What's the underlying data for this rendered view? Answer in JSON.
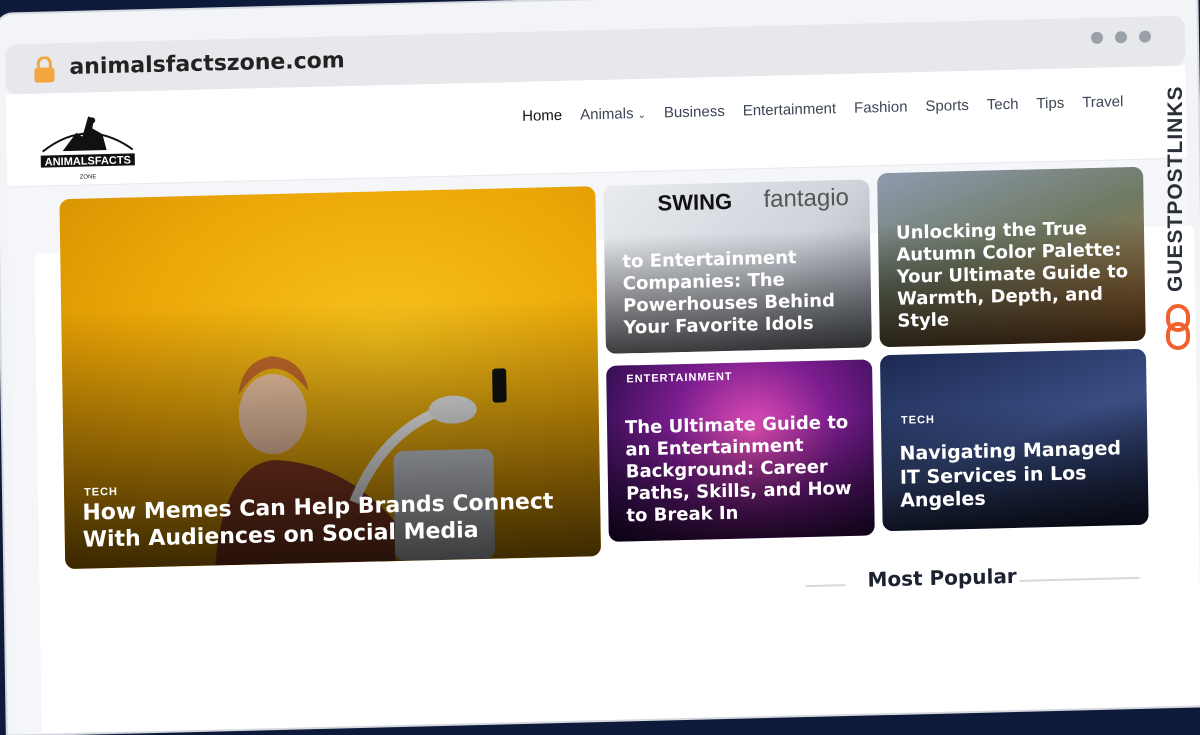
{
  "browser": {
    "url": "animalsfactszone.com"
  },
  "site": {
    "logo": {
      "name": "ANIMALSFACTS",
      "sub": "ZONE"
    },
    "nav": [
      {
        "label": "Home",
        "active": true
      },
      {
        "label": "Animals",
        "has_dropdown": true
      },
      {
        "label": "Business"
      },
      {
        "label": "Entertainment"
      },
      {
        "label": "Fashion"
      },
      {
        "label": "Sports"
      },
      {
        "label": "Tech"
      },
      {
        "label": "Tips"
      },
      {
        "label": "Travel"
      }
    ]
  },
  "featured": {
    "main": {
      "category": "TECH",
      "title": "How Memes Can Help Brands Connect With Audiences on Social Media"
    },
    "top_middle": {
      "category": "",
      "title": "to Entertainment Companies: The Powerhouses Behind Your Favorite Idols",
      "logos": [
        "SWING",
        "fantagio"
      ]
    },
    "top_right": {
      "category": "",
      "title": "Unlocking the True Autumn Color Palette: Your Ultimate Guide to Warmth, Depth, and Style"
    },
    "bottom_middle": {
      "category": "ENTERTAINMENT",
      "title": "The Ultimate Guide to an Entertainment Background: Career Paths, Skills, and How to Break In"
    },
    "bottom_right": {
      "category": "TECH",
      "title": "Navigating Managed IT Services in Los Angeles"
    }
  },
  "sections": {
    "most_popular": "Most Popular"
  },
  "watermark": {
    "text": "GUESTPOSTLINKS"
  },
  "colors": {
    "accent_orange": "#f1612f",
    "lock": "#f2a640",
    "text_dark": "#1b2230"
  }
}
